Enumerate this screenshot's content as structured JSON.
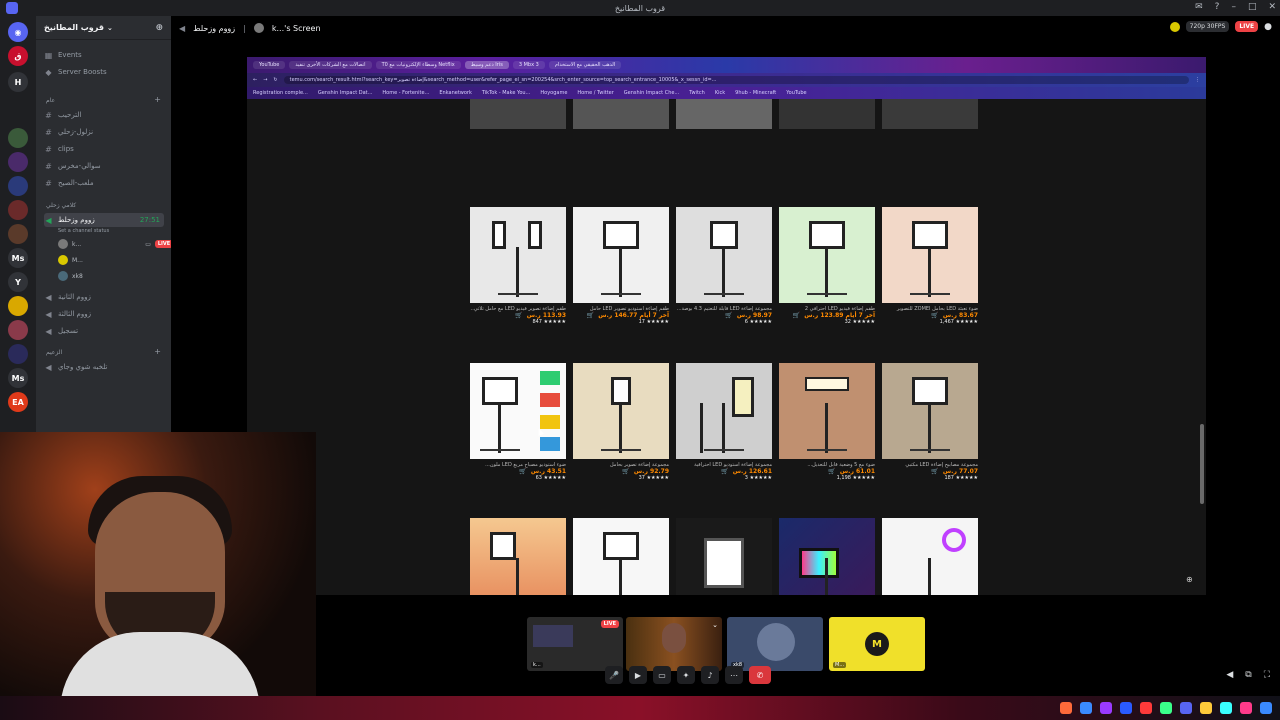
{
  "window": {
    "title": "قروب المطانيخ"
  },
  "server": {
    "name": "قروب المطانيخ",
    "top_items": [
      {
        "label": "Events",
        "icon": "calendar-icon"
      },
      {
        "label": "Server Boosts",
        "icon": "boost-icon"
      }
    ],
    "categories": [
      {
        "label": "عام"
      },
      {
        "label": "كلامي زحلي"
      },
      {
        "label": "الزعيم"
      }
    ],
    "text_channels": [
      {
        "label": "الترحيب"
      },
      {
        "label": "نزلول-زحلي"
      },
      {
        "label": "clips"
      },
      {
        "label": "سوالي-مخرس"
      },
      {
        "label": "ملعب-الصيح"
      }
    ],
    "active_voice": {
      "label": "زووم وزحلط",
      "timer": "27:51",
      "status": "Set a channel status"
    },
    "voice_users": [
      {
        "label": "k...",
        "live": "LIVE"
      },
      {
        "label": "M..."
      },
      {
        "label": "xk8"
      }
    ],
    "voice_channels": [
      {
        "label": "زووم الثانية"
      },
      {
        "label": "زووم الثالثة"
      },
      {
        "label": "تسجيل"
      },
      {
        "label": "تلخبه شوي وجاي"
      }
    ]
  },
  "stage": {
    "channel": "زووم وزحلط",
    "stream_title": "k...'s Screen",
    "quality": "720p 30FPS",
    "live": "LIVE"
  },
  "browser": {
    "tabs": [
      "YouTube",
      "اتصالات مع الشركات الأخرى تنفيذ",
      "T0 وسطاء الإلكترونيات مع Netflix",
      "دعم وسيط Iris",
      "3 Mbx 3",
      "الذهب الحقيقي مع الاستخدام"
    ],
    "url": "temu.com/search_result.html?search_key=إضاءة تصوير&search_method=user&refer_page_el_sn=200254&srch_enter_source=top_search_entrance_10005&_x_sessn_id=...",
    "bookmarks": [
      "Registration comple...",
      "Genshin Impact Dat...",
      "Home - Fortenite...",
      "Enkanetwork",
      "TikTok - Make You...",
      "Hoyogame",
      "Home / Twitter",
      "Genshin Impact Che...",
      "Twitch",
      "Kick",
      "9hub - Minecraft",
      "YouTube"
    ]
  },
  "products": [
    {
      "title": "طقم إضاءة تصوير فيديو LED مع حامل ثلاثي...",
      "price": "113.93 ر.س",
      "rating": "★★★★★ 847"
    },
    {
      "title": "طقم إضاءة استوديو تصوير LED حامل",
      "price": "آخر 7 أيام 146.77 ر.س",
      "rating": "★★★★★ 17"
    },
    {
      "title": "مجموعة إضاءة LED قابلة للتعتيم 4.3 بوصة...",
      "price": "98.97 ر.س",
      "rating": "★★★★★ 6"
    },
    {
      "title": "طقم إضاءة فيديو LED احترافي 2",
      "price": "آخر 7 أيام 123.89 ر.س",
      "rating": "★★★★★ 32"
    },
    {
      "title": "ضوء تعبئة LED بحامل ZOMEI للتصوير",
      "price": "83.67 ر.س",
      "rating": "★★★★★ 1,467"
    },
    {
      "title": "ضوء استوديو مصباح مربع LED ملون...",
      "price": "43.51 ر.س",
      "rating": "★★★★★ 63"
    },
    {
      "title": "مجموعة إضاءة تصوير بحامل",
      "price": "92.79 ر.س",
      "rating": "★★★★★ 37"
    },
    {
      "title": "مجموعة إضاءة استوديو LED احترافية",
      "price": "126.61 ر.س",
      "rating": "★★★★★ 3"
    },
    {
      "title": "ضوء مع 5 وضعية قابل للتعديل...",
      "price": "61.01 ر.س",
      "rating": "★★★★★ 1,198"
    },
    {
      "title": "مجموعة مصابيح إضاءة LED مكتبي",
      "price": "77.07 ر.س",
      "rating": "★★★★★ 187"
    }
  ],
  "tiles": [
    {
      "label": "k...",
      "live": "LIVE"
    },
    {
      "label": ""
    },
    {
      "label": "xk8"
    },
    {
      "label": "M..."
    }
  ],
  "colors": {
    "live": "#ed4245",
    "discord_bg": "#1e1f22",
    "accent_yellow": "#f0e02a"
  }
}
